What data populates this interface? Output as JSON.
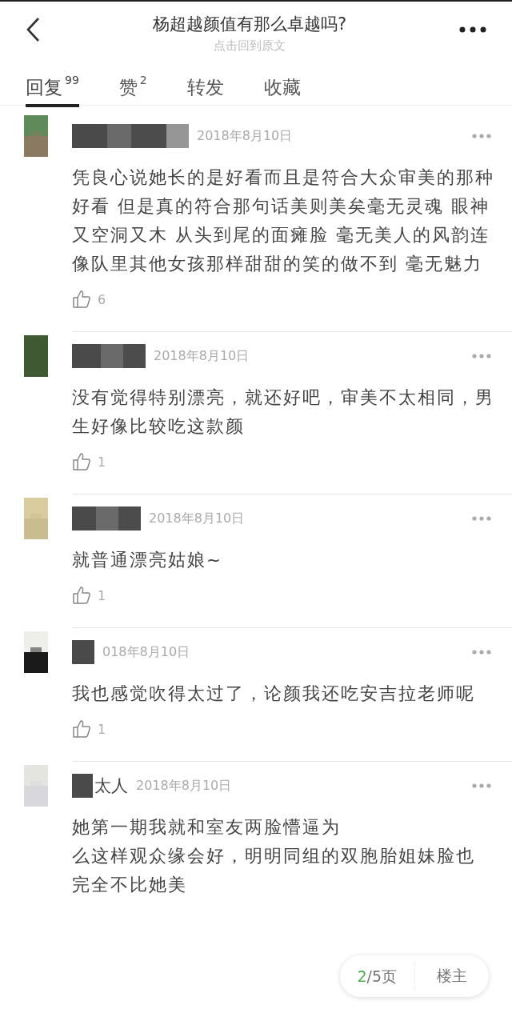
{
  "header": {
    "title": "杨超越颜值有那么卓越吗?",
    "subtitle": "点击回到原文"
  },
  "tabs": [
    {
      "label": "回复",
      "count": "99",
      "selected": true
    },
    {
      "label": "赞",
      "count": "2",
      "selected": false
    },
    {
      "label": "转发",
      "selected": false
    },
    {
      "label": "收藏",
      "selected": false
    }
  ],
  "comments": [
    {
      "date": "2018年8月10日",
      "text": [
        "凭良心说她长的是好看而且是符合大众审美的那种好看 但是真的符合那句话美则美矣毫无灵魂 眼神又空洞又木 从头到尾的面瘫脸 毫无美人的风韵连像队里其他女孩那样甜甜的笑的做不到 毫无魅力"
      ],
      "likes": "6"
    },
    {
      "date": "2018年8月10日",
      "text": [
        "没有觉得特别漂亮，就还好吧，审美不太相同，男生好像比较吃这款颜"
      ],
      "likes": "1"
    },
    {
      "date": "2018年8月10日",
      "text": [
        "就普通漂亮姑娘~"
      ],
      "likes": "1"
    },
    {
      "date": "018年8月10日",
      "text": [
        "我也感觉吹得太过了，论颜我还吃安吉拉老师呢"
      ],
      "likes": "1"
    },
    {
      "username": "太人",
      "date": "2018年8月10日",
      "text": [
        "她第一期我就和室友两脸懵逼为",
        "么这样观众缘会好，明明同组的双胞胎姐妹脸也",
        "完全不比她美"
      ]
    }
  ],
  "pager": {
    "current": "2",
    "total": "/5页",
    "owner": "楼主"
  }
}
